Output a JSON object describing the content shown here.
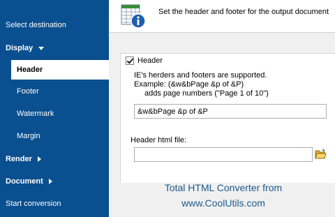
{
  "sidebar": {
    "items": [
      {
        "label": "Select destination"
      },
      {
        "label": "Display"
      },
      {
        "label": "Header"
      },
      {
        "label": "Footer"
      },
      {
        "label": "Watermark"
      },
      {
        "label": "Margin"
      },
      {
        "label": "Render"
      },
      {
        "label": "Document"
      },
      {
        "label": "Start conversion"
      }
    ],
    "background_color": "#0a4f8f",
    "selected_index": 2
  },
  "header_band": {
    "title": "Set the header and footer for the output document",
    "icon": "table-info-icon"
  },
  "form": {
    "header_checkbox": {
      "label": "Header",
      "checked": true
    },
    "info_line_1": "IE's herders and footers are supported.",
    "info_line_2": "Example:  (&w&bPage &p of &P)",
    "info_line_3": "adds page numbers (\"Page 1 of 10\")",
    "pattern_value": "&w&bPage &p of &P",
    "file_label": "Header html file:",
    "file_value": "",
    "browse_icon": "open-folder-icon"
  },
  "watermark": {
    "line_1": "Total HTML Converter from",
    "line_2": "www.CoolUtils.com",
    "color": "#1d5a8c"
  }
}
